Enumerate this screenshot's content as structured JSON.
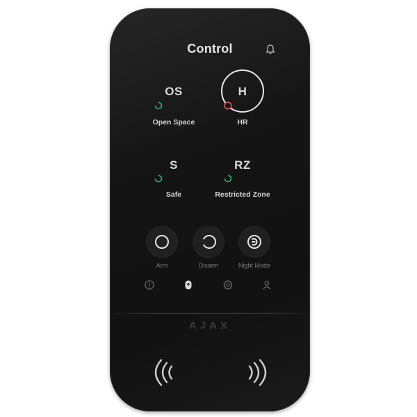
{
  "header": {
    "title": "Control"
  },
  "groups": [
    {
      "code": "OS",
      "name": "Open Space",
      "status_color": "#2fb37a"
    },
    {
      "code": "H",
      "name": "HR",
      "status_color": "#e0554f",
      "selected": true
    },
    {
      "code": "S",
      "name": "Safe",
      "status_color": "#2fb37a"
    },
    {
      "code": "RZ",
      "name": "Restricted Zone",
      "status_color": "#2fb37a"
    }
  ],
  "modes": [
    {
      "label": "Arm",
      "icon": "arm-icon"
    },
    {
      "label": "Disarm",
      "icon": "disarm-icon"
    },
    {
      "label": "Night Mode",
      "icon": "night-mode-icon"
    }
  ],
  "nav": [
    {
      "icon": "alarm-icon"
    },
    {
      "icon": "keypad-icon",
      "active": true
    },
    {
      "icon": "settings-icon"
    },
    {
      "icon": "user-icon"
    }
  ],
  "brand": {
    "logo_text": "AJAX"
  },
  "colors": {
    "accent_green": "#2fb37a",
    "accent_red": "#e0554f",
    "device_body": "#151515"
  }
}
